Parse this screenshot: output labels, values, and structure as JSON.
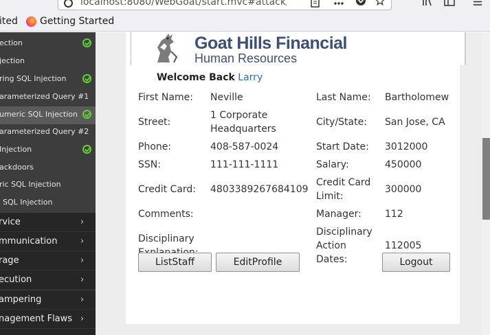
{
  "browser": {
    "url": "localhost:8080/WebGoat/start.mvc#attack/",
    "bookmarks": {
      "partial": "ited",
      "getting_started": "Getting Started"
    }
  },
  "sidebar": {
    "lessons": [
      {
        "label": "ection",
        "done": true
      },
      {
        "label": "jection",
        "done": false
      },
      {
        "label": "ring SQL Injection",
        "done": true
      },
      {
        "label": "arameterized Query #1",
        "done": false
      },
      {
        "label": "umeric SQL Injection",
        "done": true,
        "active": true
      },
      {
        "label": "arameterized Query #2",
        "done": false
      },
      {
        "label": "Injection",
        "done": true
      },
      {
        "label": "ackdoors",
        "done": false
      },
      {
        "label": "ric SQL Injection",
        "done": false
      },
      {
        "label": "SQL Injection",
        "done": false
      }
    ],
    "categories": [
      "rvice",
      "mmunication",
      "rage",
      "ecution",
      "ampering",
      "nagement Flaws",
      ""
    ]
  },
  "app": {
    "brand_title": "Goat Hills Financial",
    "brand_subtitle": "Human Resources",
    "welcome_prefix": "Welcome Back",
    "user_name": "Larry"
  },
  "profile": {
    "first_name_label": "First Name:",
    "first_name": "Neville",
    "last_name_label": "Last Name:",
    "last_name": "Bartholomew",
    "street_label": "Street:",
    "street_line1": "1 Corporate",
    "street_line2": "Headquarters",
    "city_label": "City/State:",
    "city": "San Jose, CA",
    "phone_label": "Phone:",
    "phone": "408-587-0024",
    "start_date_label": "Start Date:",
    "start_date": "3012000",
    "ssn_label": "SSN:",
    "ssn": "111-111-1111",
    "salary_label": "Salary:",
    "salary": "450000",
    "credit_card_label": "Credit Card:",
    "credit_card": "4803389267684109",
    "credit_limit_label_1": "Credit Card",
    "credit_limit_label_2": "Limit:",
    "credit_limit": "300000",
    "comments_label": "Comments:",
    "manager_label": "Manager:",
    "manager": "112",
    "disc_expl_label_1": "Disciplinary",
    "disc_expl_label_2": "Explanation:",
    "disc_dates_label_1": "Disciplinary",
    "disc_dates_label_2": "Action",
    "disc_dates_label_3": "Dates:",
    "disc_dates": "112005"
  },
  "buttons": {
    "list_staff": "ListStaff",
    "edit_profile": "EditProfile",
    "logout": "Logout"
  }
}
